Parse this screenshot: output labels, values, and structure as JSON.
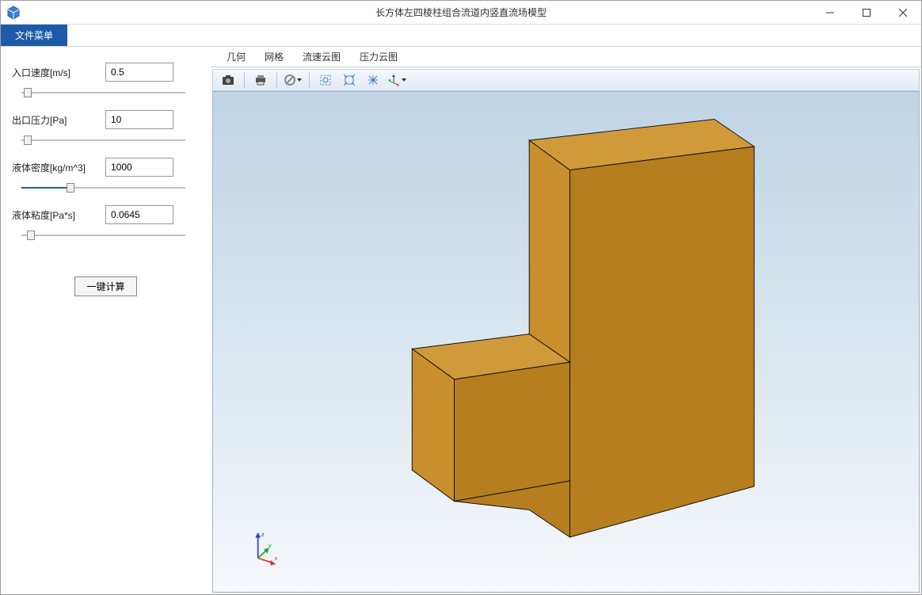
{
  "window": {
    "title": "长方体左四棱柱组合流道内竖直流场模型"
  },
  "menubar": {
    "file": "文件菜单"
  },
  "params": {
    "inlet_velocity": {
      "label": "入口速度[m/s]",
      "value": "0.5",
      "slider_pct": 4
    },
    "outlet_pressure": {
      "label": "出口压力[Pa]",
      "value": "10",
      "slider_pct": 4
    },
    "liquid_density": {
      "label": "液体密度[kg/m^3]",
      "value": "1000",
      "slider_pct": 30,
      "fill_pct": 30
    },
    "liquid_viscosity": {
      "label": "液体粘度[Pa*s]",
      "value": "0.0645",
      "slider_pct": 6
    }
  },
  "buttons": {
    "calculate": "一键计算"
  },
  "tabs": {
    "geometry": "几何",
    "mesh": "网格",
    "velocity_cloud": "流速云图",
    "pressure_cloud": "压力云图"
  },
  "toolbar_icons": {
    "screenshot": "screenshot-icon",
    "print": "print-icon",
    "clear": "clear-icon",
    "zoom_box": "zoom-box-icon",
    "zoom_extents": "zoom-extents-icon",
    "reset_view": "reset-view-icon",
    "axis_orient": "axis-orient-icon"
  },
  "axes": {
    "x": "x",
    "y": "y",
    "z": "z"
  }
}
